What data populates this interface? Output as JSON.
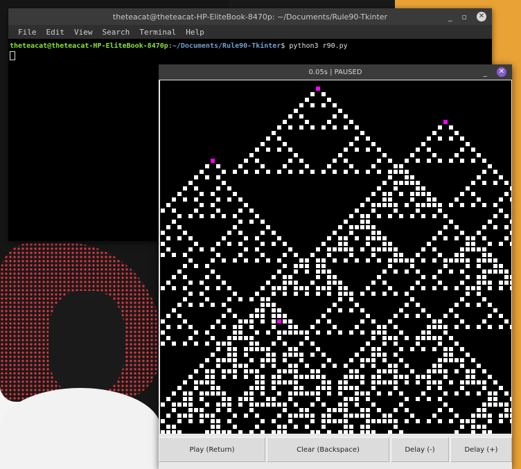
{
  "terminal": {
    "title": "theteacat@theteacat-HP-EliteBook-8470p: ~/Documents/Rule90-Tkinter",
    "minimize_glyph": "_",
    "maximize_glyph": "▫",
    "close_glyph": "✕",
    "menu": [
      "File",
      "Edit",
      "View",
      "Search",
      "Terminal",
      "Help"
    ],
    "prompt_user": "theteacat@theteacat-HP-EliteBook-8470p",
    "prompt_sep": ":",
    "prompt_path": "~/Documents/Rule90-Tkinter",
    "prompt_symbol": "$",
    "command": " python3 r90.py"
  },
  "app": {
    "title": "0.05s | PAUSED",
    "minimize_glyph": "_",
    "close_glyph": "✕",
    "cell_color": "#ffffff",
    "seed_color": "#ff00ff",
    "background_color": "#000000",
    "buttons": [
      "Play (Return)",
      "Clear (Backspace)",
      "Delay (-)",
      "Delay (+)"
    ]
  },
  "automaton": {
    "rule": 90,
    "columns": 64,
    "rows": 64,
    "seed_rows": [
      1,
      7,
      14,
      43
    ],
    "seed_cols": [
      28,
      51,
      9,
      21
    ]
  }
}
